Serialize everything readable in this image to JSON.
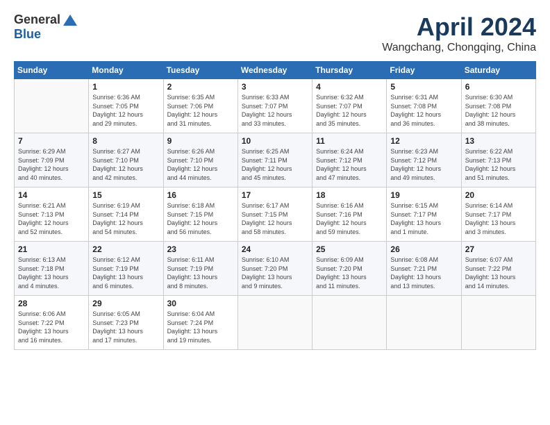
{
  "header": {
    "logo_general": "General",
    "logo_blue": "Blue",
    "month_title": "April 2024",
    "location": "Wangchang, Chongqing, China"
  },
  "weekdays": [
    "Sunday",
    "Monday",
    "Tuesday",
    "Wednesday",
    "Thursday",
    "Friday",
    "Saturday"
  ],
  "weeks": [
    [
      {
        "day": "",
        "info": ""
      },
      {
        "day": "1",
        "info": "Sunrise: 6:36 AM\nSunset: 7:05 PM\nDaylight: 12 hours\nand 29 minutes."
      },
      {
        "day": "2",
        "info": "Sunrise: 6:35 AM\nSunset: 7:06 PM\nDaylight: 12 hours\nand 31 minutes."
      },
      {
        "day": "3",
        "info": "Sunrise: 6:33 AM\nSunset: 7:07 PM\nDaylight: 12 hours\nand 33 minutes."
      },
      {
        "day": "4",
        "info": "Sunrise: 6:32 AM\nSunset: 7:07 PM\nDaylight: 12 hours\nand 35 minutes."
      },
      {
        "day": "5",
        "info": "Sunrise: 6:31 AM\nSunset: 7:08 PM\nDaylight: 12 hours\nand 36 minutes."
      },
      {
        "day": "6",
        "info": "Sunrise: 6:30 AM\nSunset: 7:08 PM\nDaylight: 12 hours\nand 38 minutes."
      }
    ],
    [
      {
        "day": "7",
        "info": "Sunrise: 6:29 AM\nSunset: 7:09 PM\nDaylight: 12 hours\nand 40 minutes."
      },
      {
        "day": "8",
        "info": "Sunrise: 6:27 AM\nSunset: 7:10 PM\nDaylight: 12 hours\nand 42 minutes."
      },
      {
        "day": "9",
        "info": "Sunrise: 6:26 AM\nSunset: 7:10 PM\nDaylight: 12 hours\nand 44 minutes."
      },
      {
        "day": "10",
        "info": "Sunrise: 6:25 AM\nSunset: 7:11 PM\nDaylight: 12 hours\nand 45 minutes."
      },
      {
        "day": "11",
        "info": "Sunrise: 6:24 AM\nSunset: 7:12 PM\nDaylight: 12 hours\nand 47 minutes."
      },
      {
        "day": "12",
        "info": "Sunrise: 6:23 AM\nSunset: 7:12 PM\nDaylight: 12 hours\nand 49 minutes."
      },
      {
        "day": "13",
        "info": "Sunrise: 6:22 AM\nSunset: 7:13 PM\nDaylight: 12 hours\nand 51 minutes."
      }
    ],
    [
      {
        "day": "14",
        "info": "Sunrise: 6:21 AM\nSunset: 7:13 PM\nDaylight: 12 hours\nand 52 minutes."
      },
      {
        "day": "15",
        "info": "Sunrise: 6:19 AM\nSunset: 7:14 PM\nDaylight: 12 hours\nand 54 minutes."
      },
      {
        "day": "16",
        "info": "Sunrise: 6:18 AM\nSunset: 7:15 PM\nDaylight: 12 hours\nand 56 minutes."
      },
      {
        "day": "17",
        "info": "Sunrise: 6:17 AM\nSunset: 7:15 PM\nDaylight: 12 hours\nand 58 minutes."
      },
      {
        "day": "18",
        "info": "Sunrise: 6:16 AM\nSunset: 7:16 PM\nDaylight: 12 hours\nand 59 minutes."
      },
      {
        "day": "19",
        "info": "Sunrise: 6:15 AM\nSunset: 7:17 PM\nDaylight: 13 hours\nand 1 minute."
      },
      {
        "day": "20",
        "info": "Sunrise: 6:14 AM\nSunset: 7:17 PM\nDaylight: 13 hours\nand 3 minutes."
      }
    ],
    [
      {
        "day": "21",
        "info": "Sunrise: 6:13 AM\nSunset: 7:18 PM\nDaylight: 13 hours\nand 4 minutes."
      },
      {
        "day": "22",
        "info": "Sunrise: 6:12 AM\nSunset: 7:19 PM\nDaylight: 13 hours\nand 6 minutes."
      },
      {
        "day": "23",
        "info": "Sunrise: 6:11 AM\nSunset: 7:19 PM\nDaylight: 13 hours\nand 8 minutes."
      },
      {
        "day": "24",
        "info": "Sunrise: 6:10 AM\nSunset: 7:20 PM\nDaylight: 13 hours\nand 9 minutes."
      },
      {
        "day": "25",
        "info": "Sunrise: 6:09 AM\nSunset: 7:20 PM\nDaylight: 13 hours\nand 11 minutes."
      },
      {
        "day": "26",
        "info": "Sunrise: 6:08 AM\nSunset: 7:21 PM\nDaylight: 13 hours\nand 13 minutes."
      },
      {
        "day": "27",
        "info": "Sunrise: 6:07 AM\nSunset: 7:22 PM\nDaylight: 13 hours\nand 14 minutes."
      }
    ],
    [
      {
        "day": "28",
        "info": "Sunrise: 6:06 AM\nSunset: 7:22 PM\nDaylight: 13 hours\nand 16 minutes."
      },
      {
        "day": "29",
        "info": "Sunrise: 6:05 AM\nSunset: 7:23 PM\nDaylight: 13 hours\nand 17 minutes."
      },
      {
        "day": "30",
        "info": "Sunrise: 6:04 AM\nSunset: 7:24 PM\nDaylight: 13 hours\nand 19 minutes."
      },
      {
        "day": "",
        "info": ""
      },
      {
        "day": "",
        "info": ""
      },
      {
        "day": "",
        "info": ""
      },
      {
        "day": "",
        "info": ""
      }
    ]
  ]
}
